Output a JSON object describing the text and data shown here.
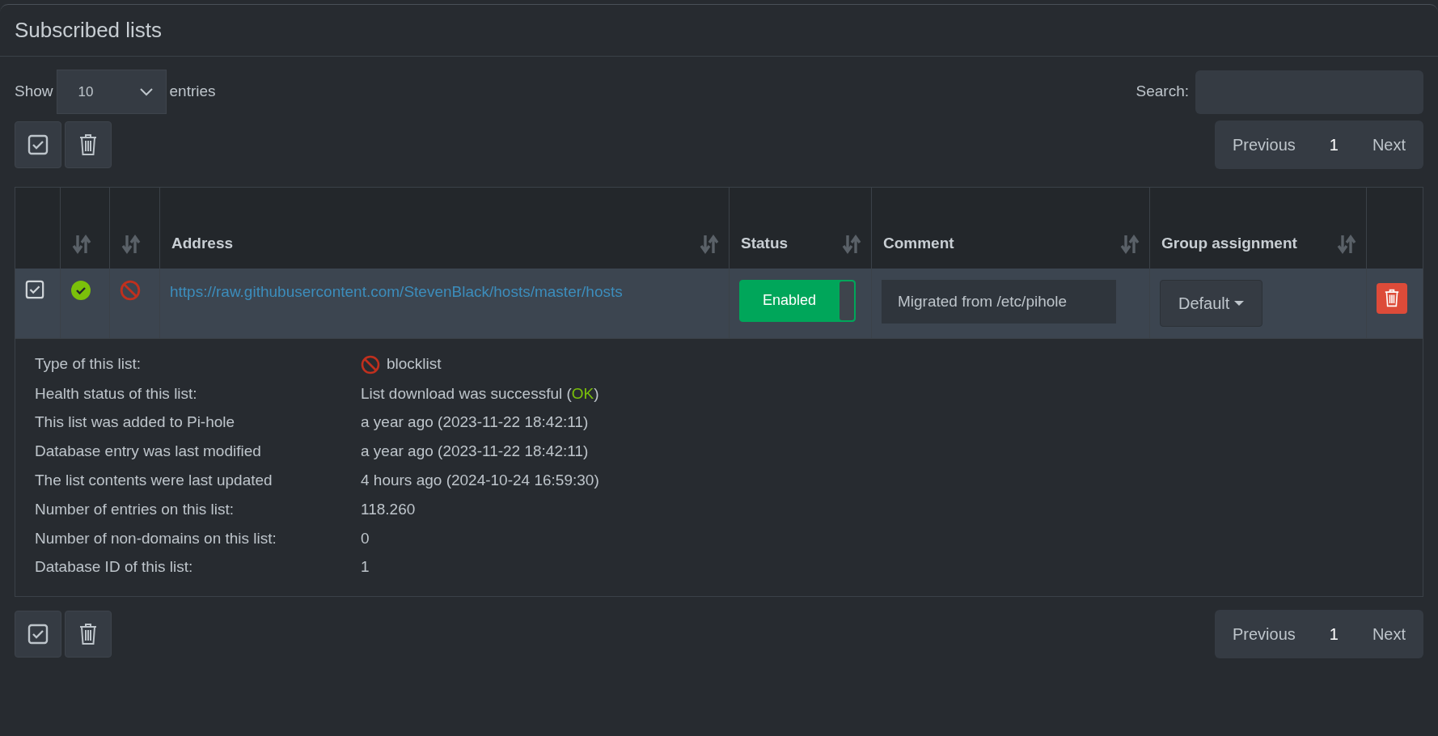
{
  "panel": {
    "title": "Subscribed lists"
  },
  "length_menu": {
    "label_before": "Show",
    "value": "10",
    "label_after": "entries"
  },
  "search": {
    "label": "Search:"
  },
  "pagination_top": {
    "previous": "Previous",
    "pages": [
      {
        "label": "1",
        "selected": true
      }
    ],
    "next": "Next"
  },
  "table": {
    "columns": [
      {
        "kind": "select",
        "sortable": false
      },
      {
        "kind": "icon",
        "sortable": true
      },
      {
        "kind": "icon",
        "sortable": true
      },
      {
        "kind": "text",
        "label": "Address",
        "sortable": true
      },
      {
        "kind": "text",
        "label": "Status",
        "sortable": true
      },
      {
        "kind": "text",
        "label": "Comment",
        "sortable": true
      },
      {
        "kind": "text",
        "label": "Group assignment",
        "sortable": true
      },
      {
        "kind": "action",
        "sortable": false
      }
    ],
    "rows": [
      {
        "checked": true,
        "healthy": true,
        "blocking": true,
        "address": "https://raw.githubusercontent.com/StevenBlack/hosts/master/hosts",
        "enabled": true,
        "status_label": "Enabled",
        "comment": "Migrated from /etc/pihole",
        "group": "Default",
        "expanded": true,
        "details": [
          {
            "kind": "type",
            "label": "Type of this list:",
            "value": "blocklist"
          },
          {
            "kind": "health",
            "label": "Health status of this list:",
            "value": "List download was successful (",
            "status": "OK",
            "value_end": ")"
          },
          {
            "kind": "text",
            "label": "This list was added to Pi-hole",
            "value": "a year ago (2023-11-22 18:42:11)"
          },
          {
            "kind": "text",
            "label": "Database entry was last modified",
            "value": "a year ago (2023-11-22 18:42:11)"
          },
          {
            "kind": "text",
            "label": "The list contents were last updated",
            "value": "4 hours ago (2024-10-24 16:59:30)"
          },
          {
            "kind": "text",
            "label": "Number of entries on this list:",
            "value": "118.260"
          },
          {
            "kind": "text",
            "label": "Number of non-domains on this list:",
            "value": "0"
          },
          {
            "kind": "text",
            "label": "Database ID of this list:",
            "value": "1"
          }
        ]
      }
    ]
  },
  "pagination_bottom": {
    "previous": "Previous",
    "pages": [
      {
        "label": "1",
        "selected": true
      }
    ],
    "next": "Next"
  }
}
